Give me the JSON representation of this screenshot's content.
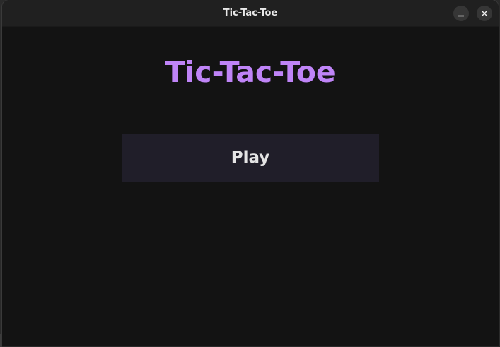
{
  "window": {
    "title": "Tic-Tac-Toe",
    "controls": [
      "minimize-icon",
      "close-icon"
    ]
  },
  "main": {
    "heading": "Tic-Tac-Toe",
    "play_label": "Play"
  },
  "colors": {
    "heading": "#bf84f7",
    "background": "#131313",
    "button_bg": "#201e29",
    "button_text": "#e4e4e4",
    "titlebar": "#202020"
  }
}
